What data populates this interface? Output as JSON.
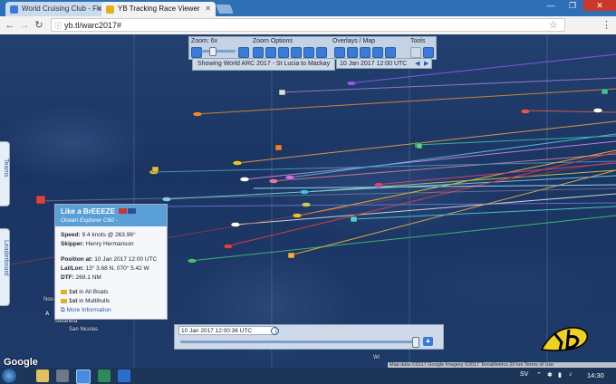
{
  "browser": {
    "tabs": [
      {
        "label": "World Cruising Club - Fle",
        "active": false
      },
      {
        "label": "YB Tracking Race Viewer",
        "active": true
      }
    ],
    "url": "yb.tl/warc2017#"
  },
  "toolbar": {
    "zoom_label": "Zoom: 6x",
    "zoom_options_label": "Zoom Options",
    "overlays_label": "Overlays / Map",
    "tools_label": "Tools",
    "showing": "Showing World ARC 2017 - St Lucia to Mackay",
    "date": "10 Jan 2017 12:00 UTC"
  },
  "side_tabs": {
    "teams": "Teams",
    "leaderboard": "Leaderboard"
  },
  "popup": {
    "boat_name": "Like a BrEEEZE",
    "boat_type": "Ocean Explorer C60 -",
    "speed_label": "Speed:",
    "speed": "9.4 knots @ 263.96°",
    "skipper_label": "Skipper:",
    "skipper": "Henry Hermanson",
    "position_label": "Position at:",
    "position_time": "10 Jan 2017 12:00 UTC",
    "latlon_label": "Lat/Lon:",
    "latlon": "13° 3.68 N, 070° 5.42 W",
    "dtf_label": "DTF:",
    "dtf": "269.1 NM",
    "rank1_pos": "1st",
    "rank1_text": "in All Boats",
    "rank2_pos": "1st",
    "rank2_text": "in Multihulls",
    "more_info": "More Information"
  },
  "timeline": {
    "label": "10 Jan 2017 12:00:36 UTC"
  },
  "map": {
    "labels": [
      "Savaneta",
      "San Nicolas",
      "Noo",
      "Wi",
      "A"
    ],
    "google": "Google",
    "attribution": "Map data ©2017 Google Imagery ©2017 TerraMetrics   20 km   Terms of Use"
  },
  "taskbar": {
    "lang": "SV",
    "time": "14:30"
  },
  "colors": {
    "accent": "#3a7bd5",
    "popup_header": "#5aa0d6"
  }
}
